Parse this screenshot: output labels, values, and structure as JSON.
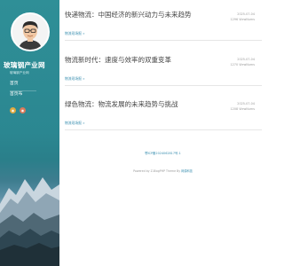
{
  "sidebar": {
    "brand": "玻璃钢产业网",
    "tagline": "玻璃钢产业网",
    "nav": [
      {
        "label": "首页"
      },
      {
        "label": "首页布"
      }
    ],
    "social": [
      {
        "icon": "weibo-icon",
        "color": "#e0a940"
      },
      {
        "icon": "rss-icon",
        "color": "#d97a5a"
      }
    ]
  },
  "posts": [
    {
      "title": "快递物流：中国经济的新兴动力与未来趋势",
      "date": "2025-07-04",
      "views": "1296 ViewNums",
      "link": "物流现场报 »"
    },
    {
      "title": "物流新时代：速度与效率的双重变革",
      "date": "2025-07-04",
      "views": "1270 ViewNums",
      "link": "物流现场报 »"
    },
    {
      "title": "绿色物流：物流发展的未来趋势与挑战",
      "date": "2025-07-04",
      "views": "1208 ViewNums",
      "link": "物流现场报 »"
    }
  ],
  "footer": {
    "icp": "鄂ICP备2024062817号-1",
    "powered_prefix": "Powered by Z-BlogPHP Theme By",
    "theme_link": "网源科技"
  },
  "colors": {
    "accent": "#2f8f97",
    "link": "#3a8fb0"
  }
}
